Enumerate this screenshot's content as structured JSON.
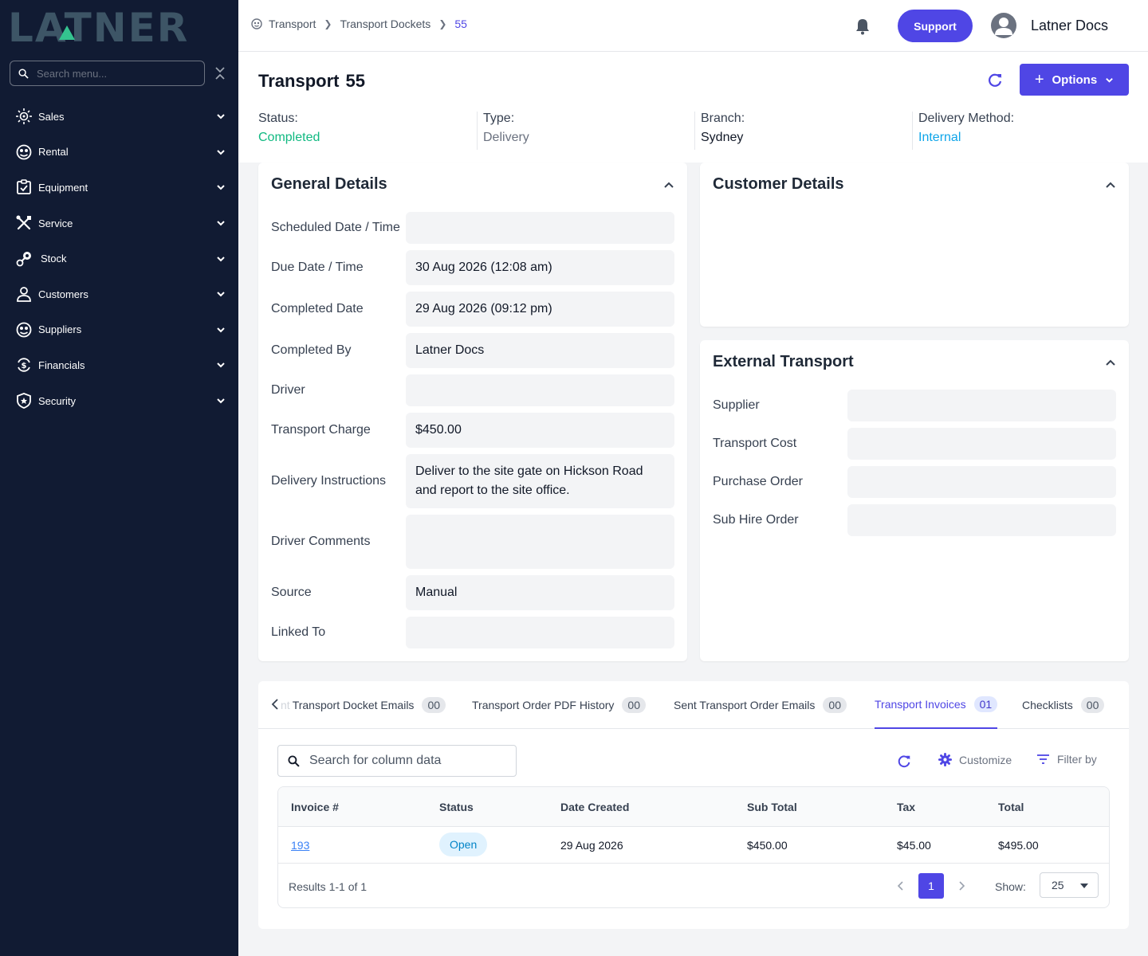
{
  "brand": {
    "logo_text": "LATNER",
    "accent": "#4f46e5"
  },
  "sidebar": {
    "search_placeholder": "Search menu...",
    "items": [
      {
        "label": "Sales",
        "icon": "sales-icon"
      },
      {
        "label": "Rental",
        "icon": "rental-icon"
      },
      {
        "label": "Equipment",
        "icon": "equipment-icon"
      },
      {
        "label": "Service",
        "icon": "service-icon"
      },
      {
        "label": "Stock",
        "icon": "stock-icon"
      },
      {
        "label": "Customers",
        "icon": "customers-icon"
      },
      {
        "label": "Suppliers",
        "icon": "suppliers-icon"
      },
      {
        "label": "Financials",
        "icon": "financials-icon"
      },
      {
        "label": "Security",
        "icon": "security-icon"
      }
    ]
  },
  "topbar": {
    "breadcrumbs": [
      "Transport",
      "Transport Dockets",
      "55"
    ],
    "support_label": "Support",
    "user_name": "Latner Docs"
  },
  "header": {
    "title": "Transport",
    "number": "55",
    "options_label": "Options",
    "meta": [
      {
        "label": "Status:",
        "value": "Completed",
        "color": "#10b981"
      },
      {
        "label": "Type:",
        "value": "Delivery",
        "color": "#6b7280"
      },
      {
        "label": "Branch:",
        "value": "Sydney",
        "color": "#111827"
      },
      {
        "label": "Delivery Method:",
        "value": "Internal",
        "color": "#0ea5e9"
      }
    ]
  },
  "general": {
    "title": "General Details",
    "fields": [
      {
        "label": "Scheduled Date / Time",
        "value": ""
      },
      {
        "label": "Due Date / Time",
        "value": "30 Aug 2026 (12:08 am)"
      },
      {
        "label": "Completed Date",
        "value": "29 Aug 2026 (09:12 pm)"
      },
      {
        "label": "Completed By",
        "value": "Latner Docs"
      },
      {
        "label": "Driver",
        "value": ""
      },
      {
        "label": "Transport Charge",
        "value": "$450.00"
      },
      {
        "label": "Delivery Instructions",
        "value": "Deliver to the site gate on Hickson Road and report to the site office."
      },
      {
        "label": "Driver Comments",
        "value": ""
      },
      {
        "label": "Source",
        "value": "Manual"
      },
      {
        "label": "Linked To",
        "value": ""
      }
    ]
  },
  "customer": {
    "title": "Customer Details"
  },
  "external": {
    "title": "External Transport",
    "fields": [
      {
        "label": "Supplier",
        "value": ""
      },
      {
        "label": "Transport Cost",
        "value": ""
      },
      {
        "label": "Purchase Order",
        "value": ""
      },
      {
        "label": "Sub Hire Order",
        "value": ""
      }
    ]
  },
  "tabs": {
    "partial_prefix": "nt",
    "items": [
      {
        "label": "Transport Docket Emails",
        "count": "00"
      },
      {
        "label": "Transport Order PDF History",
        "count": "00"
      },
      {
        "label": "Sent Transport Order Emails",
        "count": "00"
      },
      {
        "label": "Transport Invoices",
        "count": "01",
        "active": true
      },
      {
        "label": "Checklists",
        "count": "00"
      }
    ]
  },
  "table": {
    "search_placeholder": "Search for column data",
    "customize_label": "Customize",
    "filter_label": "Filter by",
    "columns": [
      "Invoice #",
      "Status",
      "Date Created",
      "Sub Total",
      "Tax",
      "Total"
    ],
    "rows": [
      {
        "invoice": "193",
        "status": "Open",
        "date": "29 Aug 2026",
        "sub_total": "$450.00",
        "tax": "$45.00",
        "total": "$495.00"
      }
    ],
    "results_text": "Results 1-1 of 1",
    "page": "1",
    "show_label": "Show:",
    "page_size": "25"
  }
}
